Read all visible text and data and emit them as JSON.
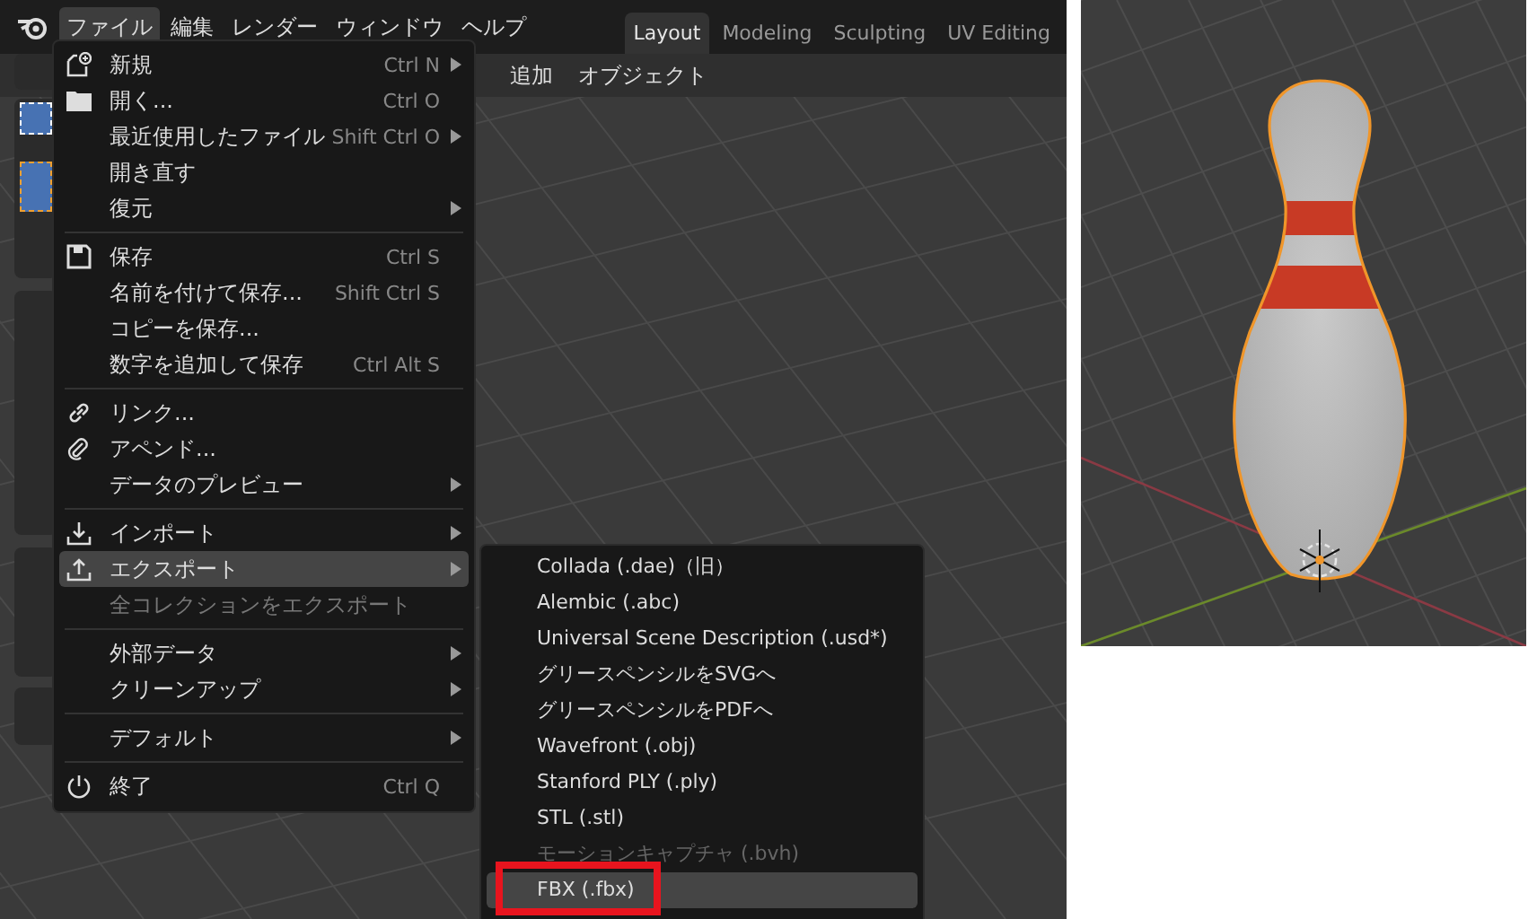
{
  "top_bar": {
    "menus": [
      {
        "label": "ファイル",
        "selected": true
      },
      {
        "label": "編集",
        "selected": false
      },
      {
        "label": "レンダー",
        "selected": false
      },
      {
        "label": "ウィンドウ",
        "selected": false
      },
      {
        "label": "ヘルプ",
        "selected": false
      }
    ],
    "workspace_tabs": [
      {
        "label": "Layout",
        "selected": true
      },
      {
        "label": "Modeling",
        "selected": false
      },
      {
        "label": "Sculpting",
        "selected": false
      },
      {
        "label": "UV Editing",
        "selected": false
      }
    ]
  },
  "viewport_header": {
    "menus": [
      "追加",
      "オブジェクト"
    ]
  },
  "file_menu": {
    "items": [
      {
        "kind": "item",
        "label": "新規",
        "shortcut": "Ctrl N",
        "has_submenu": true,
        "disabled": false,
        "selected": false
      },
      {
        "kind": "item",
        "label": "開く...",
        "shortcut": "Ctrl O",
        "has_submenu": false,
        "disabled": false,
        "selected": false
      },
      {
        "kind": "item",
        "label": "最近使用したファイル",
        "shortcut": "Shift Ctrl O",
        "has_submenu": true,
        "disabled": false,
        "selected": false
      },
      {
        "kind": "item",
        "label": "開き直す",
        "has_submenu": false,
        "disabled": false,
        "selected": false
      },
      {
        "kind": "item",
        "label": "復元",
        "has_submenu": true,
        "disabled": false,
        "selected": false
      },
      {
        "kind": "separator"
      },
      {
        "kind": "item",
        "label": "保存",
        "shortcut": "Ctrl S",
        "has_submenu": false,
        "disabled": false,
        "selected": false
      },
      {
        "kind": "item",
        "label": "名前を付けて保存...",
        "shortcut": "Shift Ctrl S",
        "has_submenu": false,
        "disabled": false,
        "selected": false
      },
      {
        "kind": "item",
        "label": "コピーを保存...",
        "has_submenu": false,
        "disabled": false,
        "selected": false
      },
      {
        "kind": "item",
        "label": "数字を追加して保存",
        "shortcut": "Ctrl Alt S",
        "has_submenu": false,
        "disabled": false,
        "selected": false
      },
      {
        "kind": "separator"
      },
      {
        "kind": "item",
        "label": "リンク...",
        "has_submenu": false,
        "disabled": false,
        "selected": false
      },
      {
        "kind": "item",
        "label": "アペンド...",
        "has_submenu": false,
        "disabled": false,
        "selected": false
      },
      {
        "kind": "item",
        "label": "データのプレビュー",
        "has_submenu": true,
        "disabled": false,
        "selected": false
      },
      {
        "kind": "separator"
      },
      {
        "kind": "item",
        "label": "インポート",
        "has_submenu": true,
        "disabled": false,
        "selected": false
      },
      {
        "kind": "item",
        "label": "エクスポート",
        "has_submenu": true,
        "disabled": false,
        "selected": true
      },
      {
        "kind": "item",
        "label": "全コレクションをエクスポート",
        "has_submenu": false,
        "disabled": true,
        "selected": false
      },
      {
        "kind": "separator"
      },
      {
        "kind": "item",
        "label": "外部データ",
        "has_submenu": true,
        "disabled": false,
        "selected": false
      },
      {
        "kind": "item",
        "label": "クリーンアップ",
        "has_submenu": true,
        "disabled": false,
        "selected": false
      },
      {
        "kind": "separator"
      },
      {
        "kind": "item",
        "label": "デフォルト",
        "has_submenu": true,
        "disabled": false,
        "selected": false
      },
      {
        "kind": "separator"
      },
      {
        "kind": "item",
        "label": "終了",
        "shortcut": "Ctrl Q",
        "has_submenu": false,
        "disabled": false,
        "selected": false
      }
    ]
  },
  "export_menu": {
    "items": [
      {
        "label": "Collada (.dae)（旧）",
        "disabled": false,
        "selected": false,
        "marked": false
      },
      {
        "label": "Alembic (.abc)",
        "disabled": false,
        "selected": false,
        "marked": false
      },
      {
        "label": "Universal Scene Description (.usd*)",
        "disabled": false,
        "selected": false,
        "marked": false
      },
      {
        "label": "グリースペンシルをSVGへ",
        "disabled": false,
        "selected": false,
        "marked": false
      },
      {
        "label": "グリースペンシルをPDFへ",
        "disabled": false,
        "selected": false,
        "marked": false
      },
      {
        "label": "Wavefront (.obj)",
        "disabled": false,
        "selected": false,
        "marked": false
      },
      {
        "label": "Stanford PLY (.ply)",
        "disabled": false,
        "selected": false,
        "marked": false
      },
      {
        "label": "STL (.stl)",
        "disabled": false,
        "selected": false,
        "marked": false
      },
      {
        "label": "モーションキャプチャ (.bvh)",
        "disabled": true,
        "selected": false,
        "marked": false
      },
      {
        "label": "FBX (.fbx)",
        "disabled": false,
        "selected": true,
        "marked": true
      }
    ]
  },
  "preview": {
    "kind": "viewport"
  }
}
